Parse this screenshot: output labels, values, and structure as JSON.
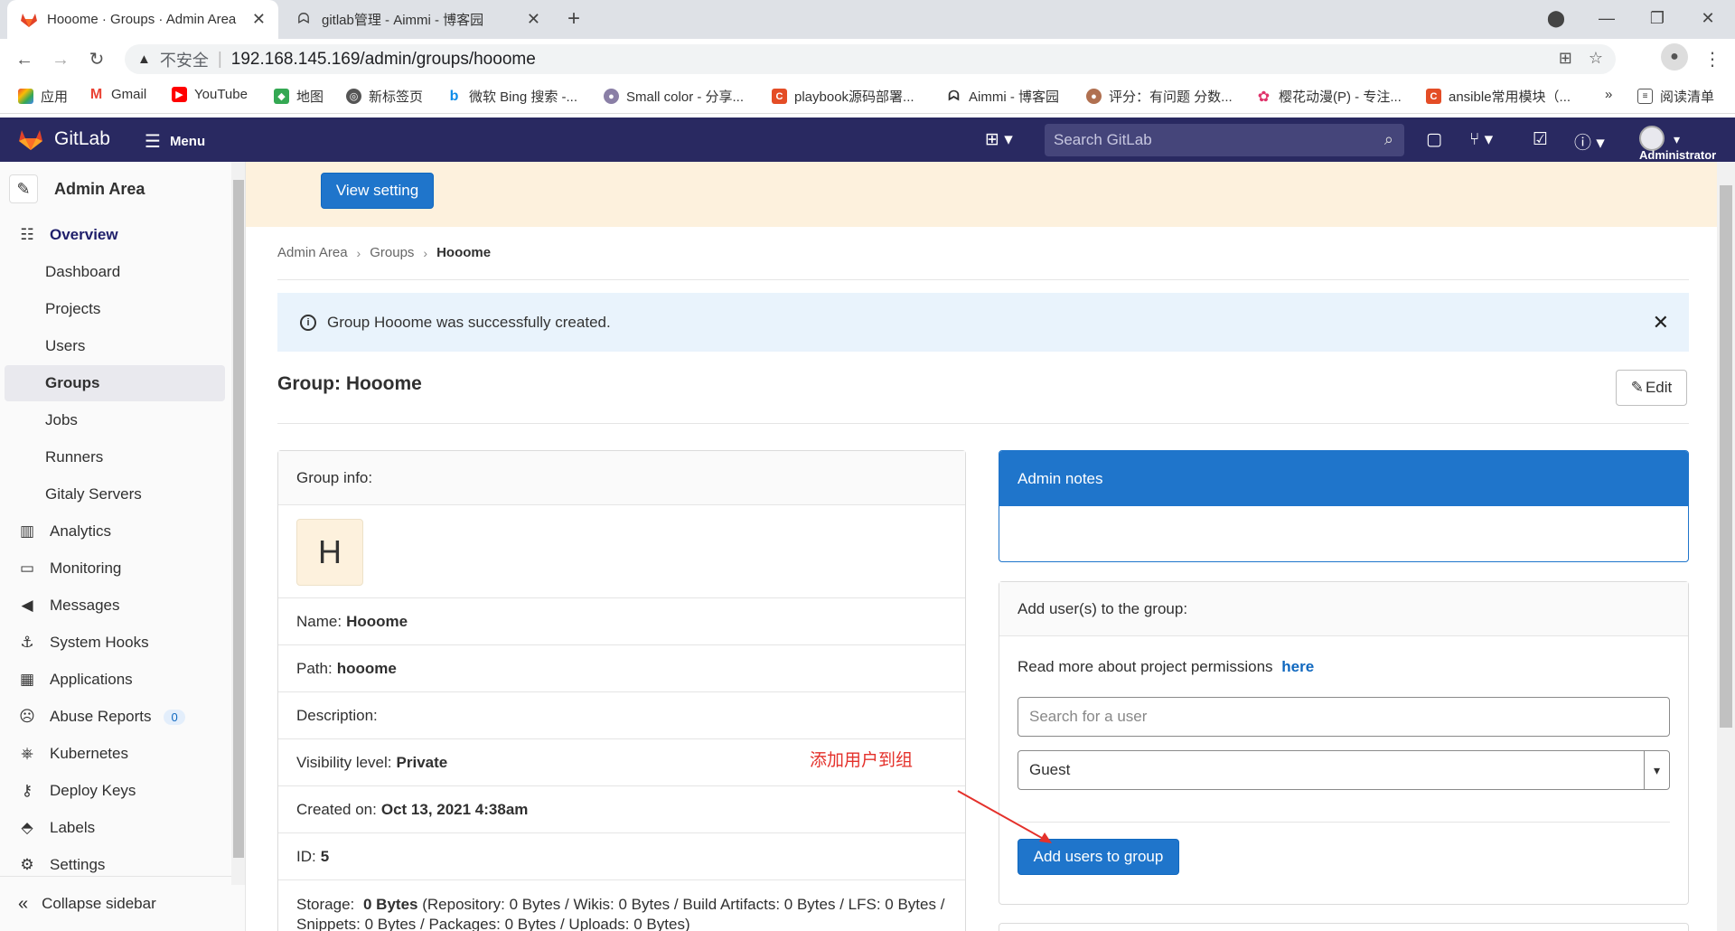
{
  "browser": {
    "tabs": [
      {
        "title": "Hooome · Groups · Admin Area",
        "favicon": "gitlab-fox-icon"
      },
      {
        "title": "gitlab管理 - Aimmi - 博客园",
        "favicon": "cnblogs-icon"
      }
    ],
    "address": {
      "insecure_label": "不安全",
      "url": "192.168.145.169/admin/groups/hooome"
    },
    "bookmarks": [
      {
        "label": "应用",
        "color": "#4285f4"
      },
      {
        "label": "Gmail",
        "color": "#ea4335"
      },
      {
        "label": "YouTube",
        "color": "#ff0000"
      },
      {
        "label": "地图",
        "color": "#34a853"
      },
      {
        "label": "新标签页",
        "color": "#555555"
      },
      {
        "label": "微软 Bing 搜索 -...",
        "color": "#0c8ce9"
      },
      {
        "label": "Small color - 分享...",
        "color": "#8a7fa6"
      },
      {
        "label": "playbook源码部署...",
        "color": "#e44d26"
      },
      {
        "label": "Aimmi - 博客园",
        "color": "#333333"
      },
      {
        "label": "评分：有问题 分数...",
        "color": "#b07050"
      },
      {
        "label": "樱花动漫(P) - 专注...",
        "color": "#e0336b"
      },
      {
        "label": "ansible常用模块（...",
        "color": "#e44d26"
      }
    ],
    "bookmarks_more": "»",
    "reading_list": "阅读清单"
  },
  "gitlab": {
    "brand": "GitLab",
    "menu_label": "Menu",
    "search_placeholder": "Search GitLab",
    "user_label": "Administrator"
  },
  "sidebar": {
    "title": "Admin Area",
    "items": [
      {
        "label": "Overview",
        "icon": "overview-icon",
        "kind": "section"
      },
      {
        "label": "Dashboard",
        "kind": "sub"
      },
      {
        "label": "Projects",
        "kind": "sub"
      },
      {
        "label": "Users",
        "kind": "sub"
      },
      {
        "label": "Groups",
        "kind": "sub-active"
      },
      {
        "label": "Jobs",
        "kind": "sub"
      },
      {
        "label": "Runners",
        "kind": "sub"
      },
      {
        "label": "Gitaly Servers",
        "kind": "sub"
      },
      {
        "label": "Analytics",
        "icon": "chart-icon",
        "kind": "top"
      },
      {
        "label": "Monitoring",
        "icon": "monitor-icon",
        "kind": "top"
      },
      {
        "label": "Messages",
        "icon": "bullhorn-icon",
        "kind": "top"
      },
      {
        "label": "System Hooks",
        "icon": "hook-icon",
        "kind": "top"
      },
      {
        "label": "Applications",
        "icon": "applications-icon",
        "kind": "top"
      },
      {
        "label": "Abuse Reports",
        "icon": "abuse-icon",
        "kind": "top",
        "badge": "0"
      },
      {
        "label": "Kubernetes",
        "icon": "kubernetes-icon",
        "kind": "top"
      },
      {
        "label": "Deploy Keys",
        "icon": "key-icon",
        "kind": "top"
      },
      {
        "label": "Labels",
        "icon": "label-icon",
        "kind": "top"
      },
      {
        "label": "Settings",
        "icon": "settings-icon",
        "kind": "top"
      }
    ],
    "collapse_label": "Collapse sidebar"
  },
  "banner": {
    "button_label": "View setting"
  },
  "breadcrumb": [
    "Admin Area",
    "Groups",
    "Hooome"
  ],
  "alert": {
    "message": "Group Hooome was successfully created."
  },
  "page": {
    "title": "Group: Hooome",
    "edit_label": "Edit"
  },
  "group_info": {
    "header": "Group info:",
    "avatar_letter": "H",
    "name_label": "Name:",
    "name_value": "Hooome",
    "path_label": "Path:",
    "path_value": "hooome",
    "description_label": "Description:",
    "visibility_label": "Visibility level:",
    "visibility_value": "Private",
    "created_label": "Created on:",
    "created_value": "Oct 13, 2021 4:38am",
    "id_label": "ID:",
    "id_value": "5",
    "storage_label": "Storage:",
    "storage_value": "0 Bytes",
    "storage_detail": "(Repository: 0 Bytes / Wikis: 0 Bytes / Build Artifacts: 0 Bytes / LFS: 0 Bytes /",
    "storage_detail_2": "Snippets: 0 Bytes / Packages: 0 Bytes / Uploads: 0 Bytes)"
  },
  "admin_notes": {
    "header": "Admin notes"
  },
  "add_users": {
    "header": "Add user(s) to the group:",
    "read_more": "Read more about project permissions",
    "here_link": "here",
    "search_placeholder": "Search for a user",
    "role_selected": "Guest",
    "submit_label": "Add users to group"
  },
  "annotation": {
    "text": "添加用户到组",
    "color": "#e4312b"
  }
}
